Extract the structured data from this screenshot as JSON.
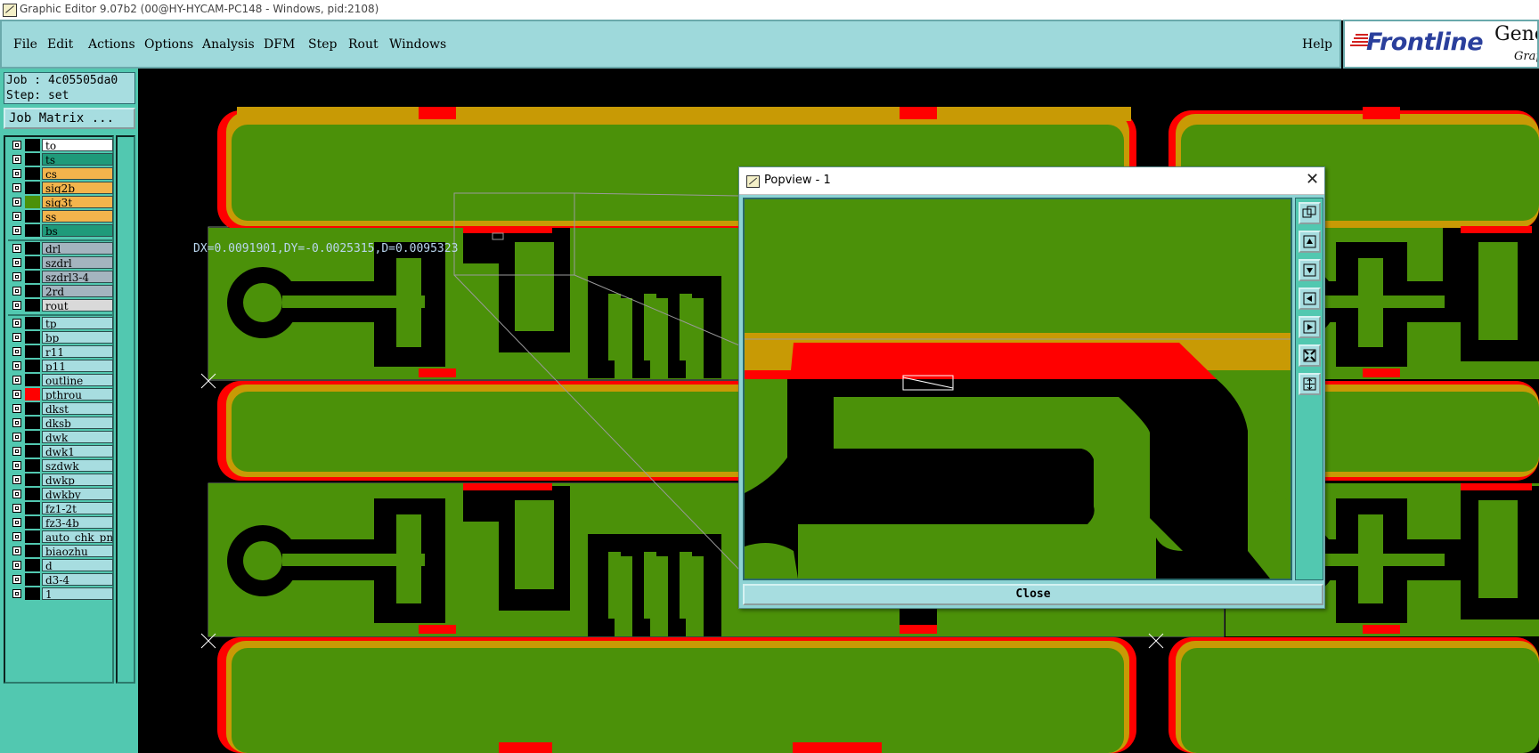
{
  "window": {
    "title": "Graphic Editor 9.07b2 (00@HY-HYCAM-PC148 - Windows, pid:2108)"
  },
  "menus": {
    "items": [
      "File",
      "Edit",
      "Actions",
      "Options",
      "Analysis",
      "DFM",
      "Step",
      "Rout",
      "Windows"
    ],
    "help": "Help"
  },
  "brand": {
    "logo": "Frontline",
    "product": "Gene",
    "product_sub": "Grap"
  },
  "job": {
    "job_line": "Job : 4c05505da0",
    "step_line": "Step: set",
    "matrix_button": "Job Matrix ..."
  },
  "layers": [
    {
      "name": "to",
      "color": "#ffffff",
      "swatch": "#000000"
    },
    {
      "name": "ts",
      "color": "#1f9a7a",
      "swatch": "#000000"
    },
    {
      "name": "cs",
      "color": "#f3b44c",
      "swatch": "#000000"
    },
    {
      "name": "sig2b",
      "color": "#f3b44c",
      "swatch": "#000000"
    },
    {
      "name": "sig3t",
      "color": "#f3b44c",
      "swatch": "#4b9109"
    },
    {
      "name": "ss",
      "color": "#f3b44c",
      "swatch": "#000000"
    },
    {
      "name": "bs",
      "color": "#1f9a7a",
      "swatch": "#000000"
    },
    {
      "name": "drl",
      "color": "#a4b4bf",
      "swatch": "#000000"
    },
    {
      "name": "szdrl",
      "color": "#a4b4bf",
      "swatch": "#000000"
    },
    {
      "name": "szdrl3-4",
      "color": "#a4b4bf",
      "swatch": "#000000"
    },
    {
      "name": "2rd",
      "color": "#a4b4bf",
      "swatch": "#000000"
    },
    {
      "name": "rout",
      "color": "#d9d9d9",
      "swatch": "#000000"
    },
    {
      "name": "tp",
      "color": "#a7dde0",
      "swatch": "#000000"
    },
    {
      "name": "bp",
      "color": "#a7dde0",
      "swatch": "#000000"
    },
    {
      "name": "r11",
      "color": "#a7dde0",
      "swatch": "#000000"
    },
    {
      "name": "p11",
      "color": "#a7dde0",
      "swatch": "#000000"
    },
    {
      "name": "outline",
      "color": "#a7dde0",
      "swatch": "#000000"
    },
    {
      "name": "pthrou",
      "color": "#a7dde0",
      "swatch": "#ff0000"
    },
    {
      "name": "dkst",
      "color": "#a7dde0",
      "swatch": "#000000"
    },
    {
      "name": "dksb",
      "color": "#a7dde0",
      "swatch": "#000000"
    },
    {
      "name": "dwk",
      "color": "#a7dde0",
      "swatch": "#000000"
    },
    {
      "name": "dwk1",
      "color": "#a7dde0",
      "swatch": "#000000"
    },
    {
      "name": "szdwk",
      "color": "#a7dde0",
      "swatch": "#000000"
    },
    {
      "name": "dwkp",
      "color": "#a7dde0",
      "swatch": "#000000"
    },
    {
      "name": "dwkby",
      "color": "#a7dde0",
      "swatch": "#000000"
    },
    {
      "name": "fz1-2t",
      "color": "#a7dde0",
      "swatch": "#000000"
    },
    {
      "name": "fz3-4b",
      "color": "#a7dde0",
      "swatch": "#000000"
    },
    {
      "name": "auto_chk_pn",
      "color": "#a7dde0",
      "swatch": "#000000"
    },
    {
      "name": "biaozhu",
      "color": "#a7dde0",
      "swatch": "#000000"
    },
    {
      "name": "d",
      "color": "#a7dde0",
      "swatch": "#000000"
    },
    {
      "name": "d3-4",
      "color": "#a7dde0",
      "swatch": "#000000"
    },
    {
      "name": "1",
      "color": "#a7dde0",
      "swatch": "#000000"
    }
  ],
  "canvas": {
    "measure": "DX=0.0091901,DY=-0.0025315,D=0.0095323",
    "colors": {
      "copper": "#4b9109",
      "outline": "#c89a05",
      "mask": "#ff0000",
      "background": "#000000"
    }
  },
  "popview": {
    "title": "Popview - 1",
    "close_label": "Close",
    "tools": [
      "zoom-fit-icon",
      "pan-up-icon",
      "pan-down-icon",
      "pan-left-icon",
      "pan-right-icon",
      "zoom-home-icon",
      "zoom-center-icon"
    ]
  }
}
